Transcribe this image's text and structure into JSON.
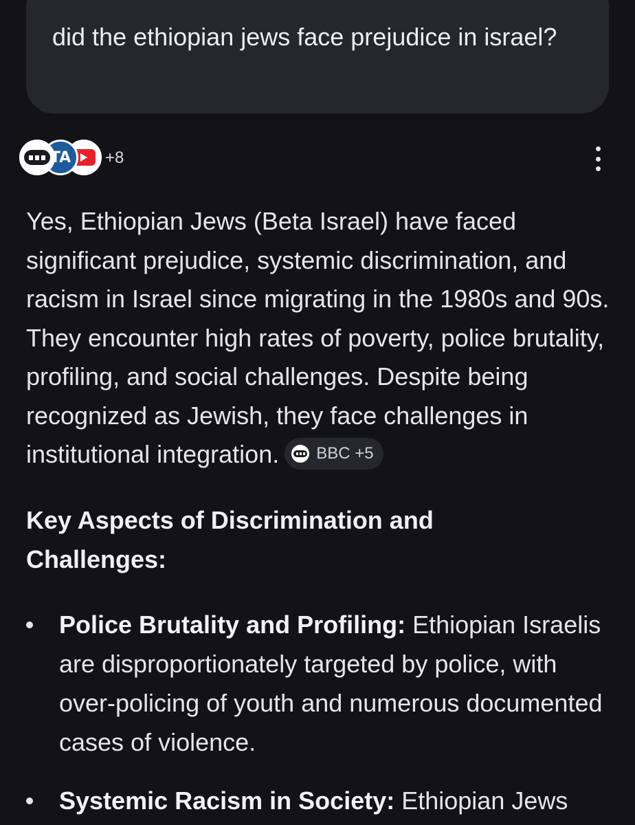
{
  "query": {
    "text": "did the ethiopian jews face prejudice in israel?"
  },
  "sources": {
    "icons": [
      "bbc-icon",
      "ta-icon",
      "youtube-icon"
    ],
    "ta_label": "TA",
    "more_count": "+8"
  },
  "answer": {
    "paragraph": "Yes, Ethiopian Jews (Beta Israel) have faced significant prejudice, systemic discrimination, and racism in Israel since migrating in the 1980s and 90s. They encounter high rates of poverty, police brutality, profiling, and social challenges. Despite being recognized as Jewish, they face challenges in institutional integration.",
    "citation_label": "BBC +5"
  },
  "section": {
    "heading": "Key Aspects of Discrimination and Challenges:"
  },
  "bullets": [
    {
      "title": "Police Brutality and Profiling:",
      "text": " Ethiopian Israelis are disproportionately targeted by police, with over-policing of youth and numerous documented cases of violence."
    },
    {
      "title": "Systemic Racism in Society:",
      "text": " Ethiopian Jews"
    }
  ]
}
